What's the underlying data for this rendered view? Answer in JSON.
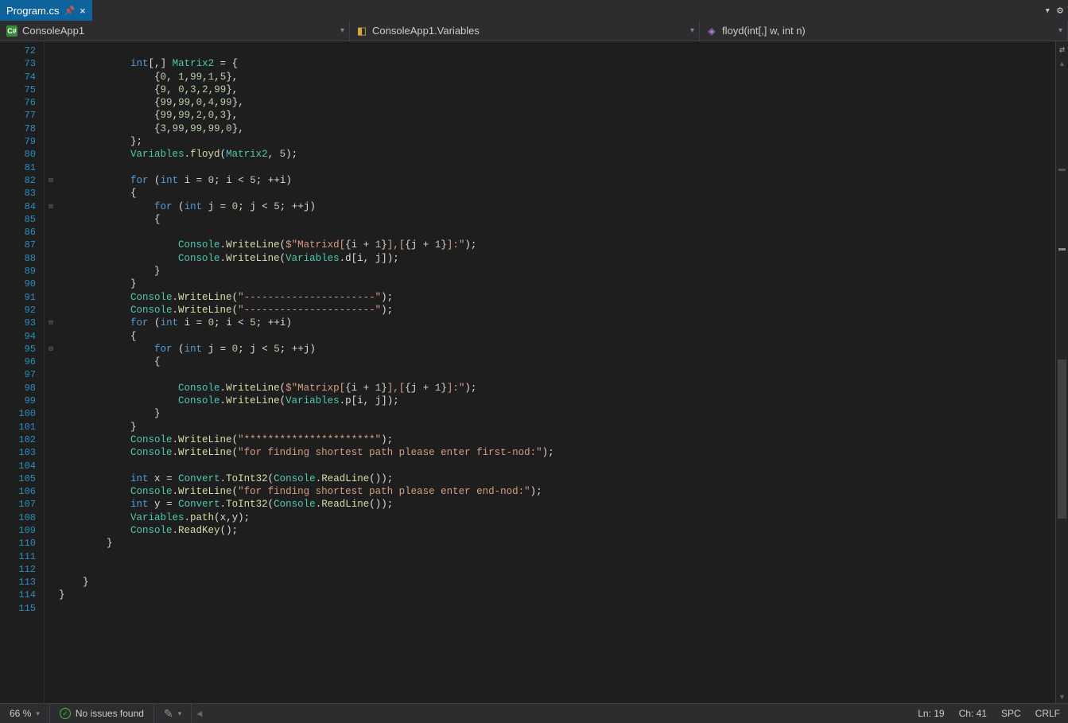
{
  "tab": {
    "title": "Program.cs"
  },
  "nav": {
    "project": "ConsoleApp1",
    "class": "ConsoleApp1.Variables",
    "method": "floyd(int[,] w, int n)"
  },
  "editor": {
    "first_line": 72,
    "lines": [
      "",
      "            int[,] Matrix2 = {",
      "                {0, 1,99,1,5},",
      "                {9, 0,3,2,99},",
      "                {99,99,0,4,99},",
      "                {99,99,2,0,3},",
      "                {3,99,99,99,0},",
      "            };",
      "            Variables.floyd(Matrix2, 5);",
      "",
      "            for (int i = 0; i < 5; ++i)",
      "            {",
      "                for (int j = 0; j < 5; ++j)",
      "                {",
      "",
      "                    Console.WriteLine($\"Matrixd[{i + 1}],[{j + 1}]:\");",
      "                    Console.WriteLine(Variables.d[i, j]);",
      "                }",
      "            }",
      "            Console.WriteLine(\"----------------------\");",
      "            Console.WriteLine(\"----------------------\");",
      "            for (int i = 0; i < 5; ++i)",
      "            {",
      "                for (int j = 0; j < 5; ++j)",
      "                {",
      "",
      "                    Console.WriteLine($\"Matrixp[{i + 1}],[{j + 1}]:\");",
      "                    Console.WriteLine(Variables.p[i, j]);",
      "                }",
      "            }",
      "            Console.WriteLine(\"**********************\");",
      "            Console.WriteLine(\"for finding shortest path please enter first-nod:\");",
      "",
      "            int x = Convert.ToInt32(Console.ReadLine());",
      "            Console.WriteLine(\"for finding shortest path please enter end-nod:\");",
      "            int y = Convert.ToInt32(Console.ReadLine());",
      "            Variables.path(x,y);",
      "            Console.ReadKey();",
      "        }",
      "",
      "",
      "    }",
      "}",
      ""
    ]
  },
  "status": {
    "zoom": "66 %",
    "issues": "No issues found",
    "line": "Ln: 19",
    "col": "Ch: 41",
    "spaces": "SPC",
    "lineend": "CRLF"
  }
}
